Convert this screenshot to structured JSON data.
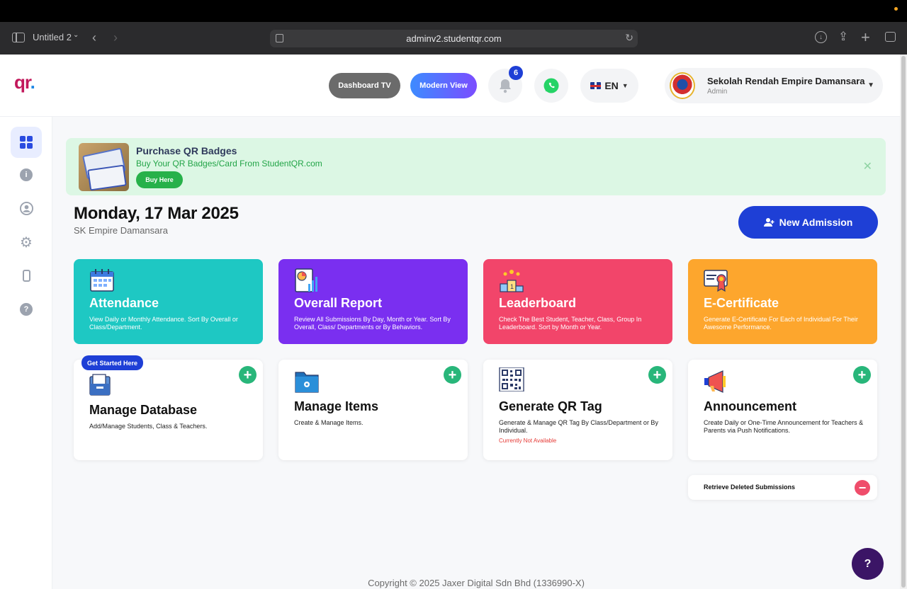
{
  "browser": {
    "tab_title": "Untitled 2",
    "url": "adminv2.studentqr.com"
  },
  "header": {
    "logo_text": "qr",
    "logo_dot": ".",
    "dashboard_tv_label": "Dashboard TV",
    "modern_view_label": "Modern View",
    "notification_count": "6",
    "language": "EN",
    "school_name": "Sekolah Rendah Empire Damansara",
    "user_role": "Admin"
  },
  "promo": {
    "title": "Purchase QR Badges",
    "subtitle": "Buy Your QR Badges/Card From StudentQR.com",
    "button_label": "Buy Here",
    "close_symbol": "✕"
  },
  "main": {
    "date": "Monday, 17 Mar 2025",
    "school_short": "SK Empire Damansara",
    "new_admission_label": "New Admission"
  },
  "cards": {
    "attendance": {
      "title": "Attendance",
      "desc": "View Daily or Monthly Attendance. Sort By Overall or Class/Department.",
      "color": "#1ec8c3"
    },
    "overall_report": {
      "title": "Overall Report",
      "desc": "Review All Submissions By Day, Month or Year. Sort By Overall, Class/ Departments or By Behaviors.",
      "color": "#7a2ff0"
    },
    "leaderboard": {
      "title": "Leaderboard",
      "desc": "Check The Best Student, Teacher, Class, Group In Leaderboard. Sort by Month or Year.",
      "color": "#f2456a"
    },
    "ecertificate": {
      "title": "E-Certificate",
      "desc": "Generate E-Certificate For Each of Individual For Their Awesome Performance.",
      "color": "#fda62d"
    },
    "manage_database": {
      "badge": "Get Started Here",
      "title": "Manage Database",
      "desc": "Add/Manage Students, Class & Teachers."
    },
    "manage_items": {
      "title": "Manage Items",
      "desc": "Create & Manage Items."
    },
    "generate_qr": {
      "title": "Generate QR Tag",
      "desc": "Generate & Manage QR Tag By Class/Department or By Individual.",
      "note": "Currently Not Available"
    },
    "announcement": {
      "title": "Announcement",
      "desc": "Create Daily or One-Time Announcement for Teachers & Parents via Push Notifications."
    }
  },
  "retrieve": {
    "label": "Retrieve Deleted Submissions"
  },
  "footer": {
    "copyright": "Copyright © 2025 Jaxer Digital Sdn Bhd (1336990-X)"
  },
  "help": {
    "symbol": "?"
  },
  "icons": {
    "plus": "+",
    "minus": "−",
    "info": "i"
  }
}
